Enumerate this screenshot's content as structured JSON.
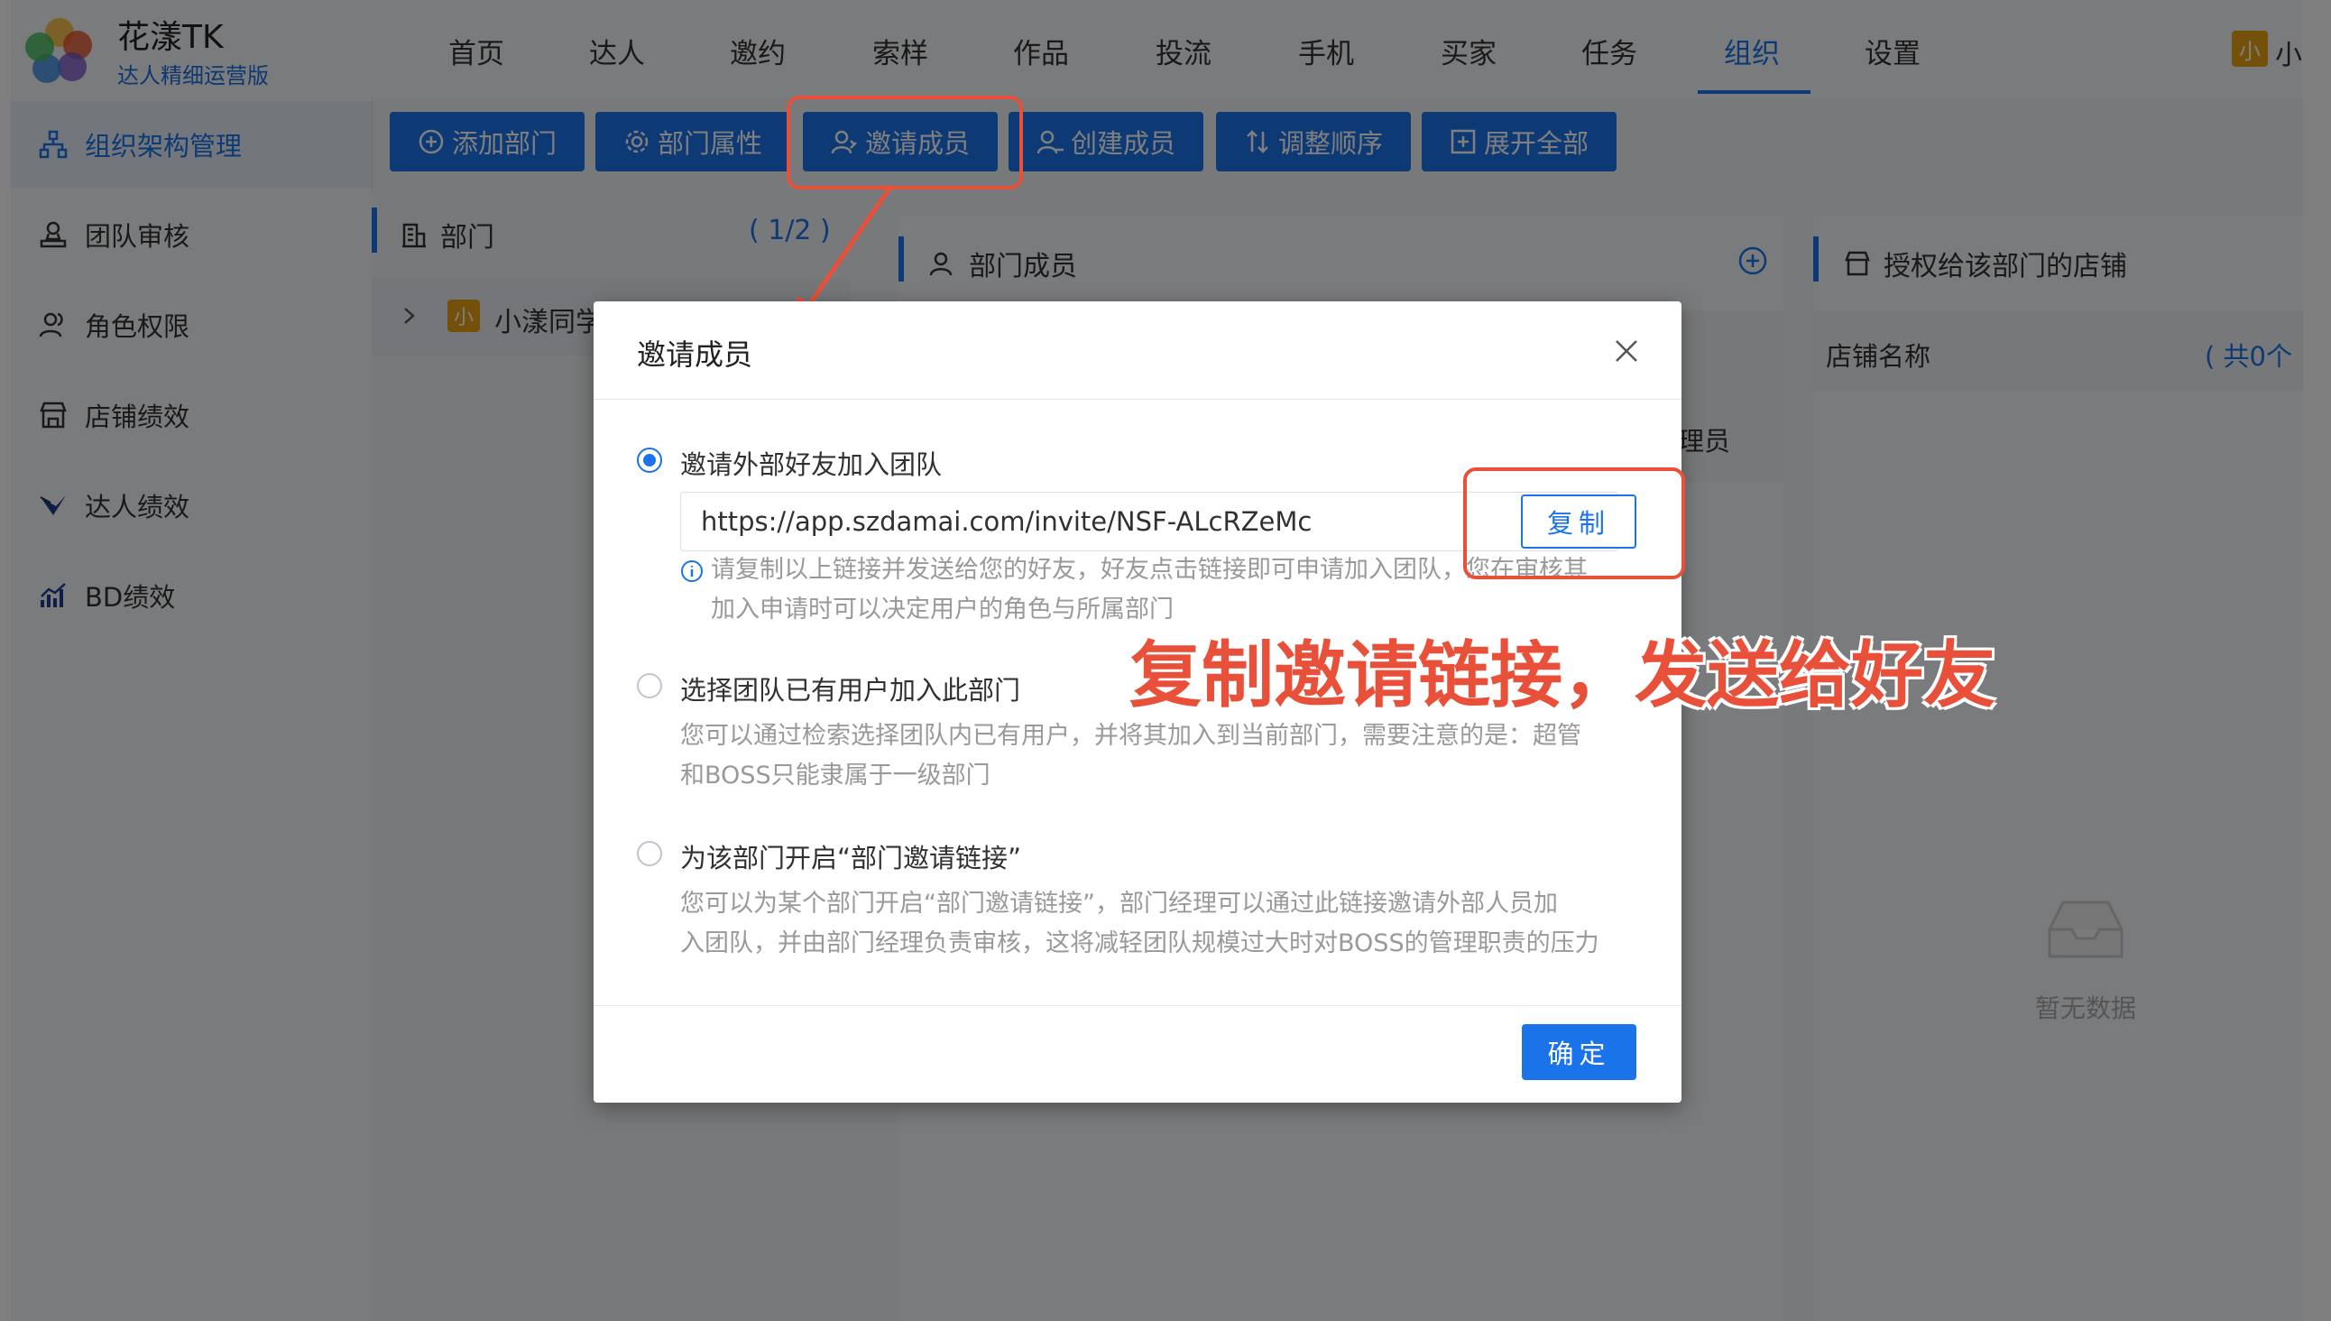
{
  "app": {
    "name": "花漾TK",
    "subtitle": "达人精细运营版",
    "user_initial": "小",
    "user_name_partial": "小漾"
  },
  "nav": {
    "items": [
      "首页",
      "达人",
      "邀约",
      "索样",
      "作品",
      "投流",
      "手机",
      "买家",
      "任务",
      "组织",
      "设置"
    ],
    "active": "组织"
  },
  "sidebar": {
    "items": [
      {
        "label": "组织架构管理",
        "icon": "org-chart-icon",
        "active": true
      },
      {
        "label": "团队审核",
        "icon": "stamp-icon"
      },
      {
        "label": "角色权限",
        "icon": "users-icon"
      },
      {
        "label": "店铺绩效",
        "icon": "store-icon"
      },
      {
        "label": "达人绩效",
        "icon": "influencer-icon"
      },
      {
        "label": "BD绩效",
        "icon": "bar-chart-icon"
      }
    ]
  },
  "toolbar": {
    "add_dept": "添加部门",
    "dept_props": "部门属性",
    "invite_member": "邀请成员",
    "create_member": "创建成员",
    "adjust_order": "调整顺序",
    "expand_all": "展开全部"
  },
  "dept_panel": {
    "title": "部门",
    "count": "( 1/2 )",
    "tree_item": "小漾同学",
    "tree_initial": "小"
  },
  "members_panel": {
    "title": "部门成员",
    "partial_text": "理员"
  },
  "shops_panel": {
    "title": "授权给该部门的店铺",
    "column": "店铺名称",
    "count": "( 共0个",
    "empty": "暂无数据"
  },
  "modal": {
    "title": "邀请成员",
    "option1": {
      "label": "邀请外部好友加入团队",
      "link": "https://app.szdamai.com/invite/NSF-ALcRZeMc",
      "copy": "复制",
      "hint_line1": "请复制以上链接并发送给您的好友，好友点击链接即可申请加入团队，您在审核其",
      "hint_line2": "加入申请时可以决定用户的角色与所属部门"
    },
    "option2": {
      "label": "选择团队已有用户加入此部门",
      "desc_line1": "您可以通过检索选择团队内已有用户，并将其加入到当前部门，需要注意的是：超管",
      "desc_line2": "和BOSS只能隶属于一级部门"
    },
    "option3": {
      "label": "为该部门开启“部门邀请链接”",
      "desc_line1": "您可以为某个部门开启“部门邀请链接”，部门经理可以通过此链接邀请外部人员加",
      "desc_line2": "入团队，并由部门经理负责审核，这将减轻团队规模过大时对BOSS的管理职责的压力"
    },
    "confirm": "确定"
  },
  "annotation": {
    "text": "复制邀请链接，发送给好友"
  },
  "colors": {
    "primary": "#1a73e8",
    "annotation": "#e8503a",
    "overlay": "rgba(0,0,0,0.5)"
  }
}
